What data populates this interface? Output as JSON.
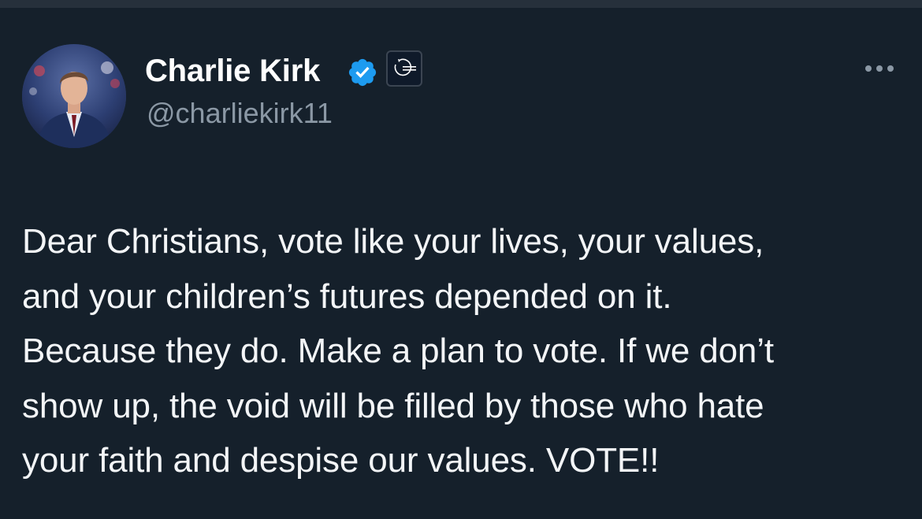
{
  "author": {
    "display_name": "Charlie Kirk",
    "handle": "@charliekirk11",
    "verified_icon": "verified-badge-icon",
    "affiliate_badge": "Turning Point USA logo",
    "affiliate_badge_text": "TURNING POINT USA"
  },
  "menu": {
    "more_icon": "more-options-icon"
  },
  "tweet": {
    "lines": [
      "Dear Christians, vote like your lives, your values,",
      "and your children’s futures depended on it.",
      "Because they do. Make a plan to vote. If we don’t",
      "show up, the void will be filled by those who hate",
      "your faith and despise our values. VOTE!!"
    ]
  },
  "colors": {
    "background": "#15202b",
    "verified_blue": "#1d9bf0",
    "secondary_text": "#8b98a5",
    "primary_text": "#f3f5f7"
  }
}
